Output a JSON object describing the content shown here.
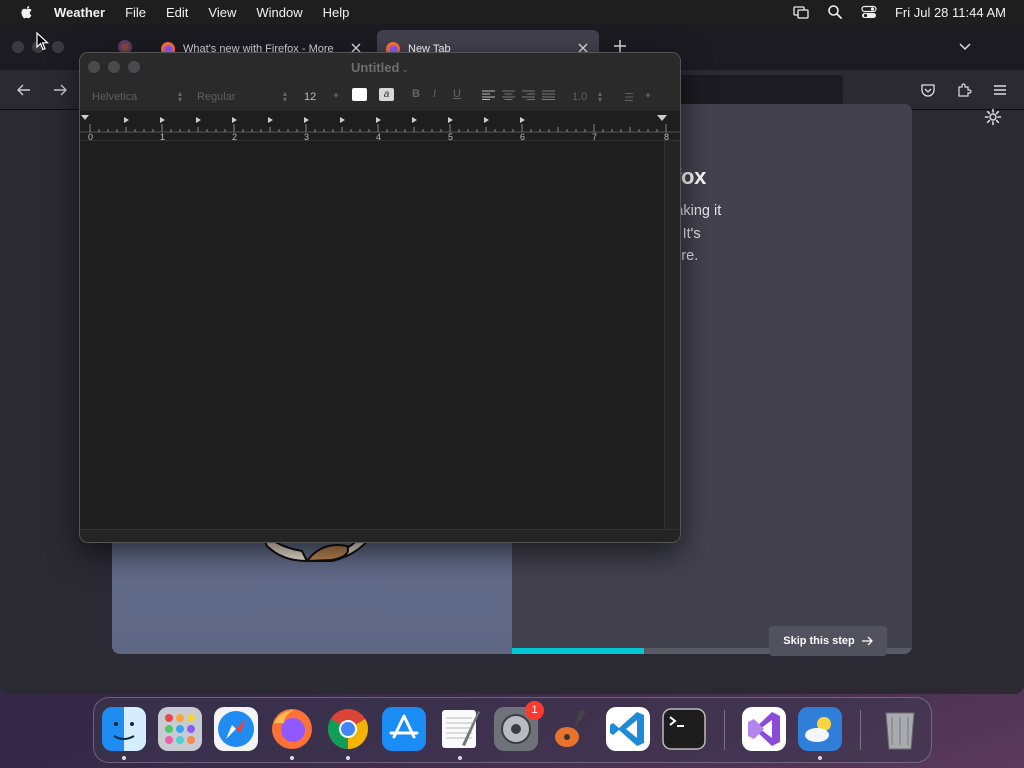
{
  "menubar": {
    "app_name": "Weather",
    "items": [
      "File",
      "Edit",
      "View",
      "Window",
      "Help"
    ],
    "clock": "Fri Jul 28  11:44 AM"
  },
  "firefox": {
    "tabs": [
      {
        "title": "What's new with Firefox - More",
        "active": false
      },
      {
        "title": "New Tab",
        "active": true
      }
    ],
    "onboarding": {
      "heading": "r loving Firefox",
      "body_lines": [
        "built around you, making it",
        "kip around the web. It's",
        "s we think you'll adore."
      ],
      "skip_label": "Skip this step",
      "progress": 0.33
    }
  },
  "textedit": {
    "title": "Untitled",
    "font_family": "Helvetica",
    "font_style": "Regular",
    "font_size": "12",
    "bold": "B",
    "italic": "I",
    "underline": "U",
    "line_spacing": "1.0",
    "ruler_labels": [
      "0",
      "1",
      "2",
      "3",
      "4",
      "5",
      "6",
      "7",
      "8"
    ]
  },
  "dock": {
    "apps": [
      "Finder",
      "Launchpad",
      "Safari",
      "Firefox",
      "Chrome",
      "App Store",
      "TextEdit",
      "System Settings",
      "GarageBand",
      "Visual Studio Code",
      "Terminal",
      "Visual Studio",
      "Weather",
      "Trash"
    ],
    "settings_badge": "1"
  }
}
